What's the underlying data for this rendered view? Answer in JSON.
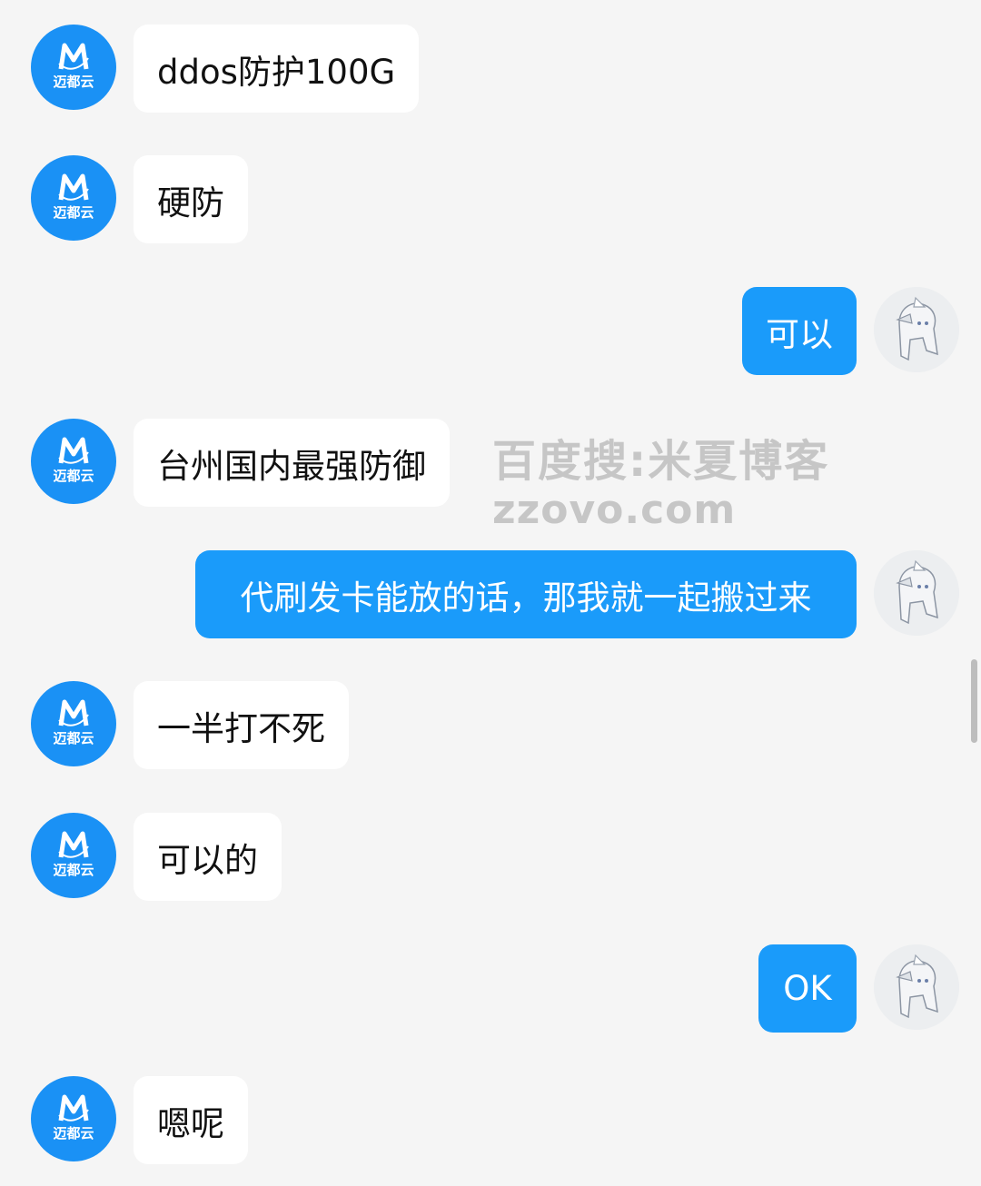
{
  "contact": {
    "avatar_label": "迈都云",
    "avatar_icon": "m-logo-icon",
    "brand_color": "#1a91f5"
  },
  "self": {
    "avatar_icon": "anime-girl-avatar"
  },
  "bubble_colors": {
    "self": "#1a9bfa",
    "other": "#ffffff",
    "background": "#f5f5f5"
  },
  "messages": [
    {
      "from": "other",
      "text": "ddos防护100G"
    },
    {
      "from": "other",
      "text": "硬防"
    },
    {
      "from": "self",
      "text": "可以"
    },
    {
      "from": "other",
      "text": "台州国内最强防御"
    },
    {
      "from": "self",
      "text": "代刷发卡能放的话，那我就一起搬过来"
    },
    {
      "from": "other",
      "text": "一半打不死"
    },
    {
      "from": "other",
      "text": "可以的"
    },
    {
      "from": "self",
      "text": "OK"
    },
    {
      "from": "other",
      "text": "嗯呢"
    }
  ],
  "watermark": {
    "line1": "百度搜:米夏博客",
    "line2": "zzovo.com"
  }
}
